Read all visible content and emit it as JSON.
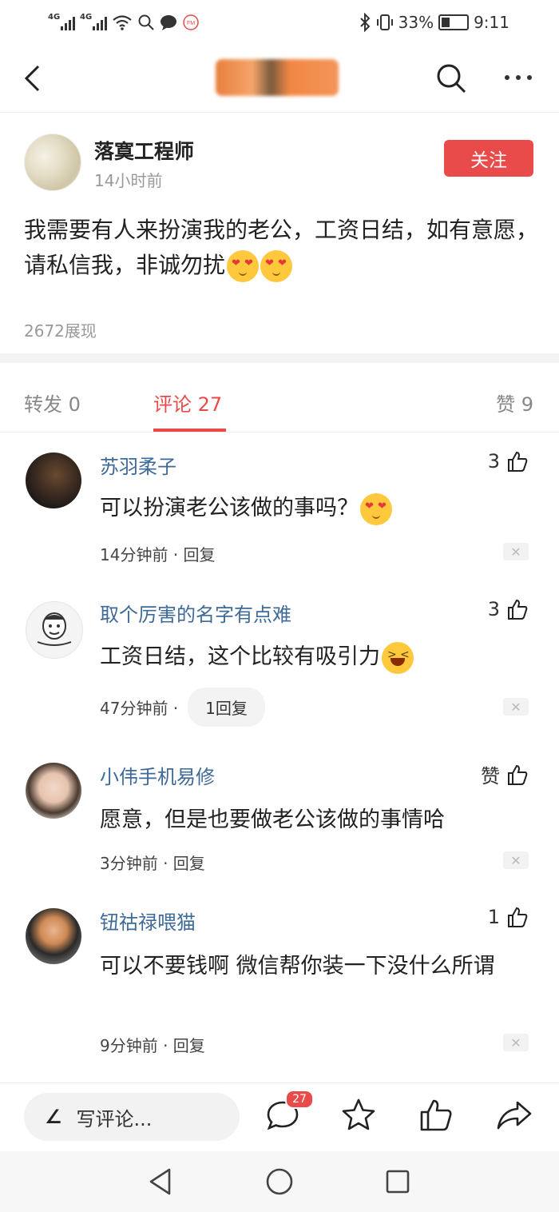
{
  "status_bar": {
    "net1": "4G",
    "net2": "4G",
    "battery": "33%",
    "time": "9:11",
    "icons": [
      "signal-icon",
      "wifi-icon",
      "search-status-icon",
      "chat-bubble-icon",
      "fm-icon",
      "bluetooth-icon",
      "vibrate-icon",
      "battery-icon"
    ]
  },
  "nav": {
    "icons": [
      "back-arrow-icon",
      "search-icon",
      "more-icon"
    ]
  },
  "post": {
    "author": "落寞工程师",
    "time": "14小时前",
    "follow_label": "关注",
    "text": "我需要有人来扮演我的老公，工资日结，如有意愿，请私信我，非诚勿扰",
    "views": "2672展现"
  },
  "tabs": {
    "repost": "转发 0",
    "comment": "评论 27",
    "like": "赞 9"
  },
  "comments": [
    {
      "name": "苏羽柔子",
      "likes": "3",
      "text": "可以扮演老公该做的事吗？",
      "time": "14分钟前 · 回复"
    },
    {
      "name": "取个厉害的名字有点难",
      "likes": "3",
      "text": "工资日结，这个比较有吸引力",
      "time": "47分钟前 ·",
      "replies": "1回复"
    },
    {
      "name": "小伟手机易修",
      "likes": "赞",
      "text": "愿意，但是也要做老公该做的事情哈",
      "time": "3分钟前 · 回复"
    },
    {
      "name": "钮祜禄喂猫",
      "likes": "1",
      "text": "可以不要钱啊 微信帮你装一下没什么所谓",
      "time": "9分钟前 · 回复"
    }
  ],
  "bottom_bar": {
    "write_label": "写评论...",
    "comment_badge": "27",
    "icons": [
      "pen-icon",
      "comment-icon",
      "star-icon",
      "thumbs-up-icon",
      "share-icon"
    ]
  },
  "system_nav": {
    "icons": [
      "back-triangle-icon",
      "home-circle-icon",
      "recents-square-icon"
    ]
  },
  "colors": {
    "accent": "#e94a4a",
    "link": "#3e6a99"
  }
}
